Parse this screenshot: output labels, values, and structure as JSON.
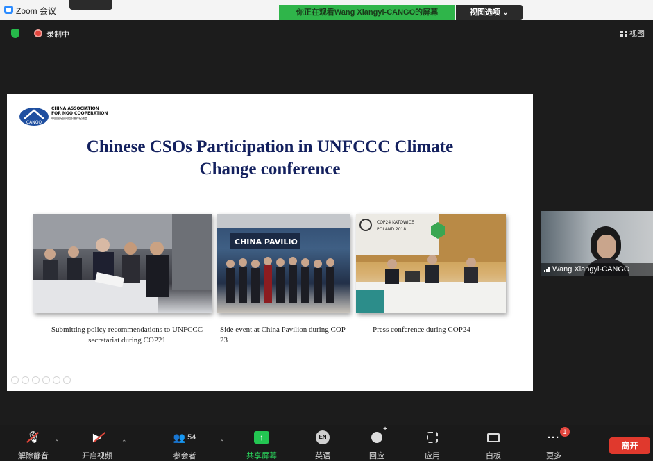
{
  "window": {
    "app_title": "Zoom 会议"
  },
  "top_banner": {
    "viewing_label": "你正在观看Wang Xiangyi-CANGO的屏幕",
    "view_options_label": "视图选项 ⌄"
  },
  "status": {
    "recording_label": "录制中",
    "view_label": "视图"
  },
  "slide": {
    "logo": {
      "line1": "CHINA ASSOCIATION",
      "line2": "FOR NGO COOPERATION",
      "line3": "中国国际民间组织合作促进会",
      "emblem_text": "CANGO"
    },
    "title_line1": "Chinese CSOs Participation in  UNFCCC Climate",
    "title_line2": "Change conference",
    "photo_texts": {
      "pavilion_sign": "CHINA PAVILIO",
      "cop24_sign_1": "COP24 KATOWICE",
      "cop24_sign_2": "POLAND 2018"
    },
    "captions": [
      "Submitting policy recommendations to UNFCCC secretariat during COP21",
      "Side event at China Pavilion during COP 23",
      "Press conference during COP24"
    ]
  },
  "video_tile": {
    "name": "Wang Xiangyi-CANGO"
  },
  "toolbar": {
    "unmute_label": "解除静音",
    "start_video_label": "开启视频",
    "participants_count": "54",
    "participants_label": "参会者",
    "share_screen_label": "共享屏幕",
    "language_icon_text": "EN",
    "language_label": "英语",
    "reactions_label": "回应",
    "apps_label": "应用",
    "whiteboard_label": "白板",
    "more_label": "更多",
    "more_badge": "1",
    "leave_label": "离开"
  },
  "colors": {
    "viewing_banner_bg": "#2fb54a",
    "slide_title": "#13205e",
    "share_accent": "#23c552",
    "leave_button": "#e0392d",
    "recording_dot": "#e3463e"
  },
  "icons": [
    "zoom-app-icon",
    "shield-icon",
    "record-icon",
    "grid-icon",
    "signal-icon",
    "mic-muted-icon",
    "video-off-icon",
    "participants-icon",
    "share-icon",
    "language-icon",
    "reaction-icon",
    "apps-icon",
    "whiteboard-icon",
    "more-icon"
  ]
}
